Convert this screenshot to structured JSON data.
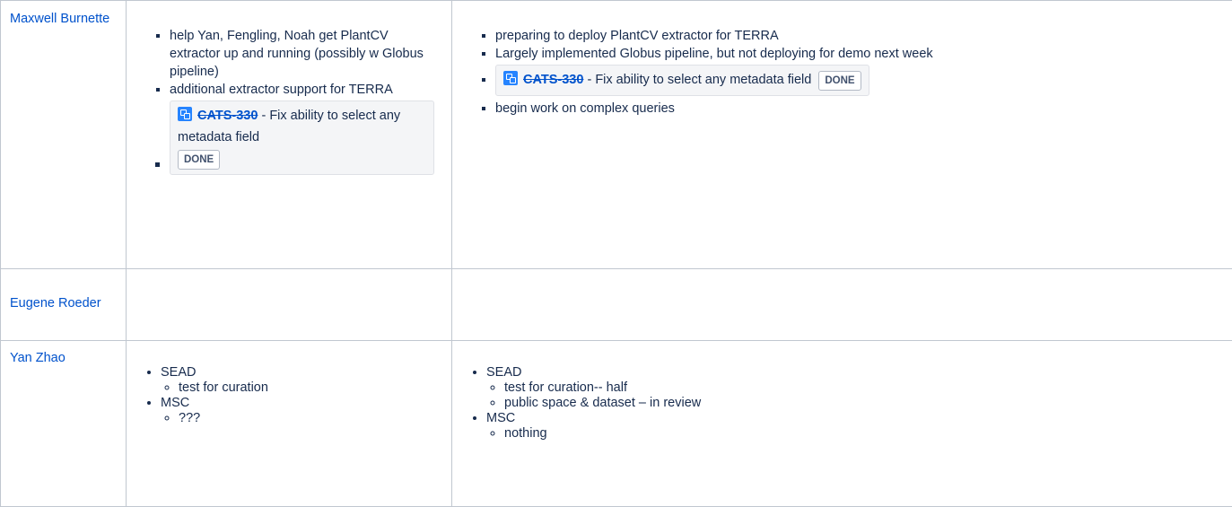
{
  "rows": [
    {
      "person": "Maxwell Burnette",
      "col1": {
        "items": [
          "help Yan, Fengling, Noah get PlantCV extractor up and running (possibly w Globus pipeline)",
          "additional extractor support for TERRA"
        ],
        "jira": {
          "key": "CATS-330",
          "separator": " - ",
          "summary": "Fix ability to select any metadata field",
          "status": "DONE"
        }
      },
      "col2": {
        "items": [
          "preparing to deploy PlantCV extractor for TERRA",
          "Largely implemented Globus pipeline, but not deploying for demo next week"
        ],
        "jira": {
          "key": "CATS-330",
          "separator": " - ",
          "summary": "Fix ability to select any metadata field",
          "status": "DONE"
        },
        "items_after": [
          "begin work on complex queries"
        ]
      }
    },
    {
      "person": "Eugene Roeder"
    },
    {
      "person": "Yan Zhao",
      "col1": [
        {
          "label": "SEAD",
          "sub": [
            "test for curation"
          ]
        },
        {
          "label": "MSC",
          "sub": [
            "???"
          ]
        }
      ],
      "col2": [
        {
          "label": "SEAD",
          "sub": [
            "test for curation-- half",
            "public space & dataset – in review"
          ]
        },
        {
          "label": "MSC",
          "sub": [
            "nothing"
          ]
        }
      ]
    }
  ],
  "colors": {
    "link": "#0052cc",
    "border": "#c1c7d0",
    "jira_bg": "#f4f5f7",
    "jira_icon": "#2684ff"
  }
}
